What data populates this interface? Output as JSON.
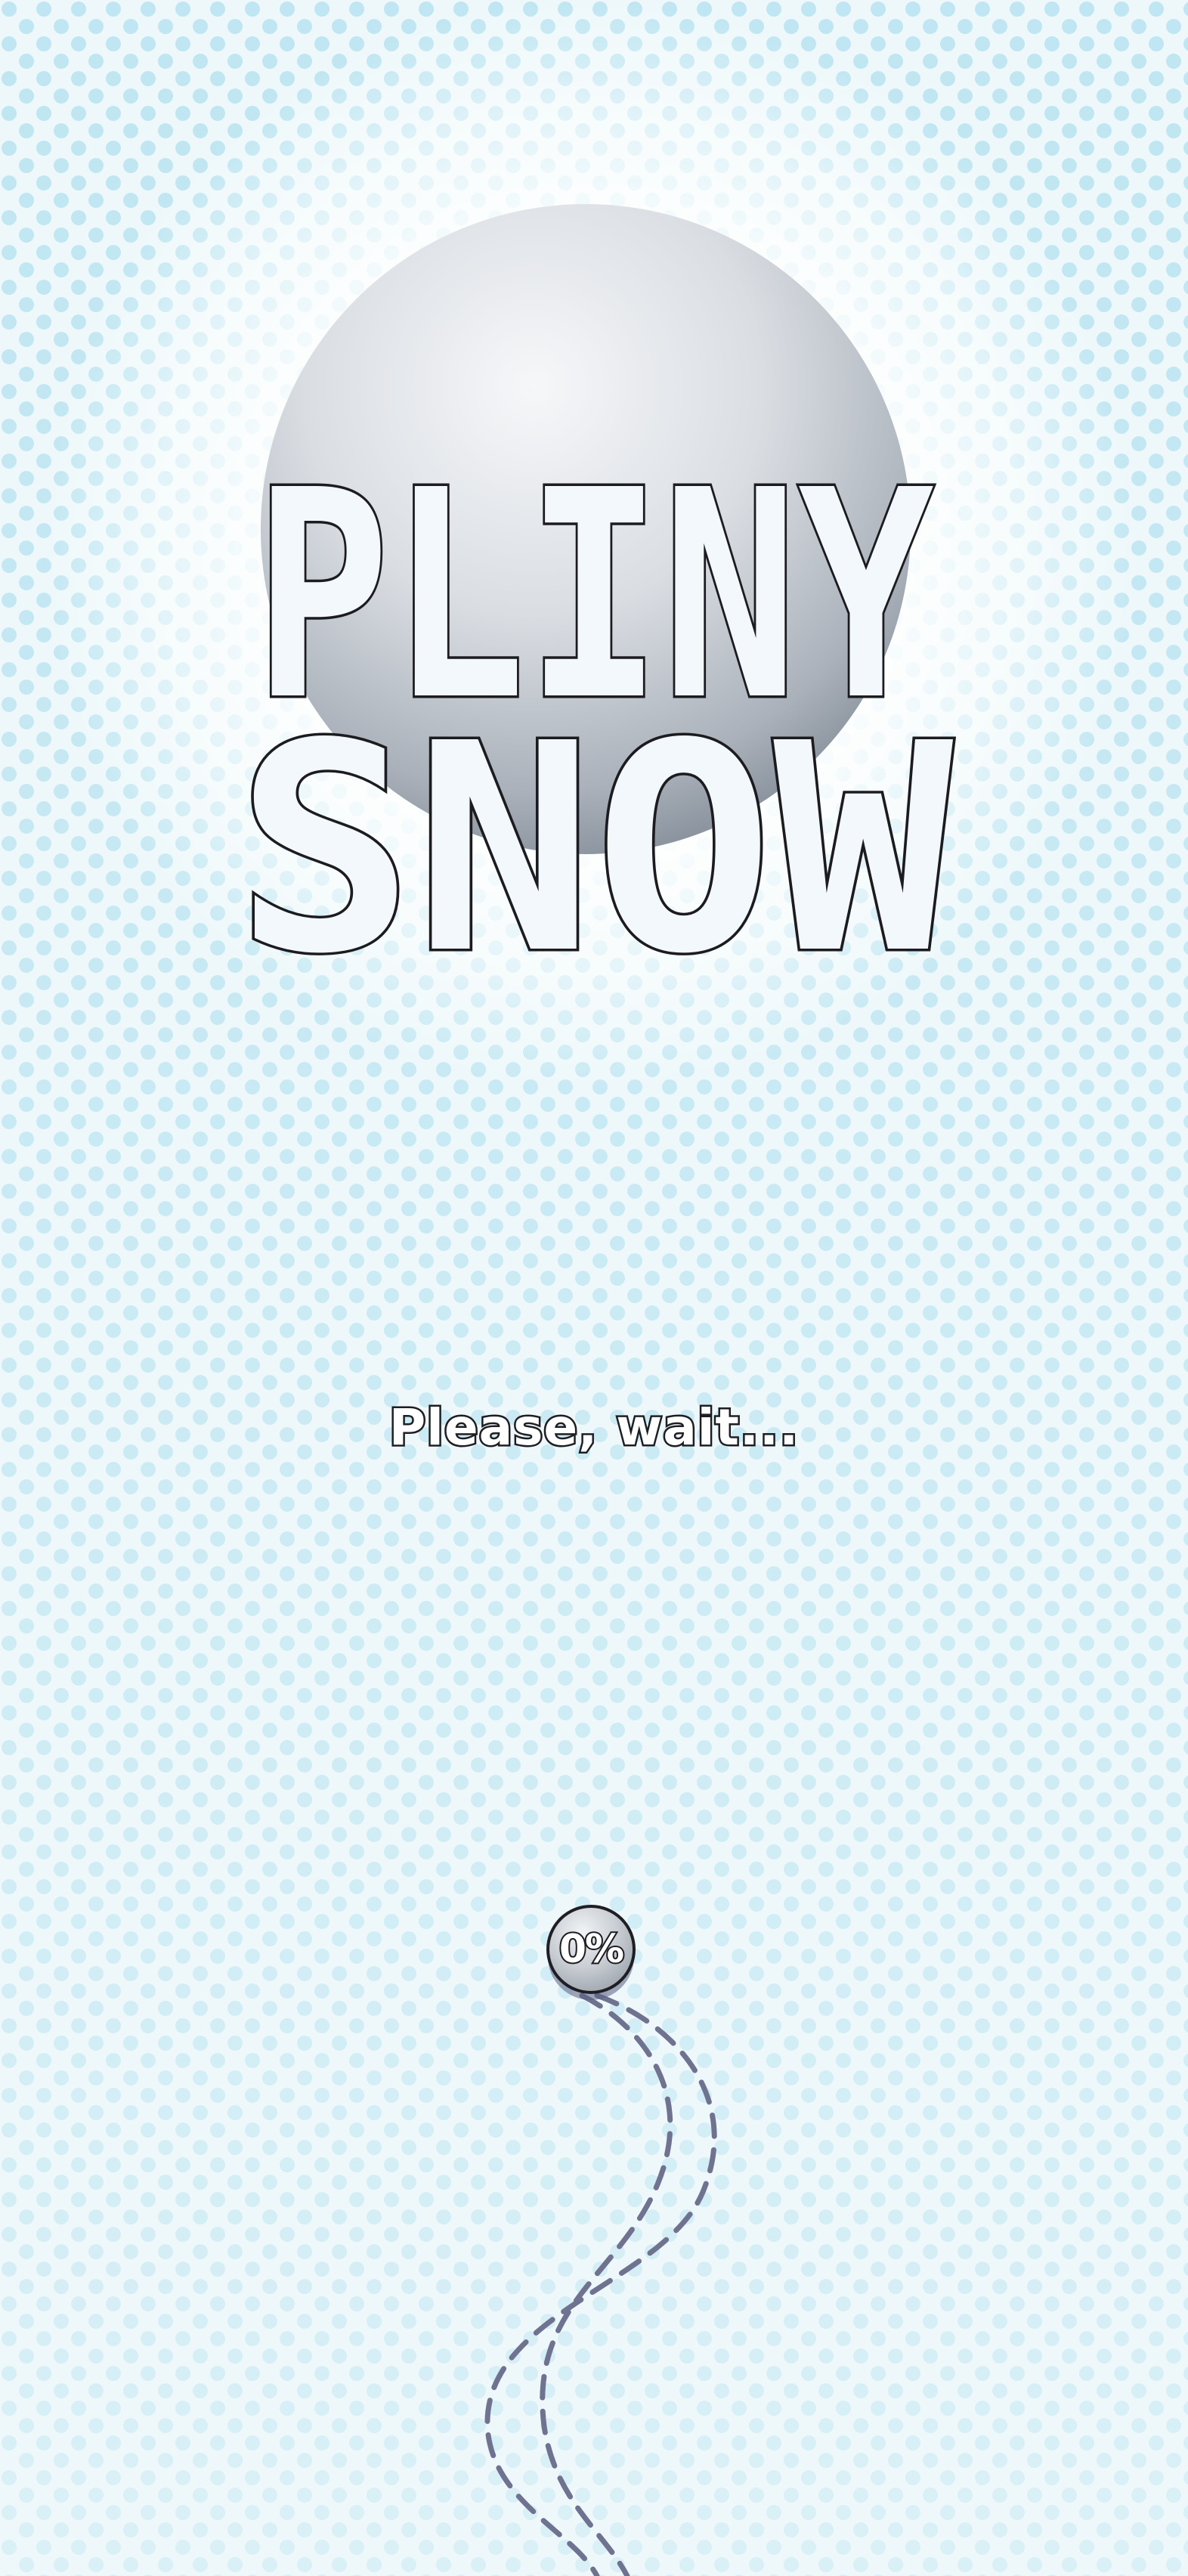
{
  "game": {
    "title_line1": "PLINY",
    "title_line2": "SNOW",
    "loading_text": "Please, wait...",
    "progress_label": "0%",
    "progress_value": 0
  },
  "colors": {
    "background": "#eef8fa",
    "dots": "#bfe6f2",
    "title_fill": "#f2f8fb",
    "title_outline": "#1b1b20",
    "trail": "#6f7390",
    "snowball": "#b8bfc7"
  },
  "icons": {
    "snowball": "snowball-icon",
    "trail": "dashed-trail"
  }
}
